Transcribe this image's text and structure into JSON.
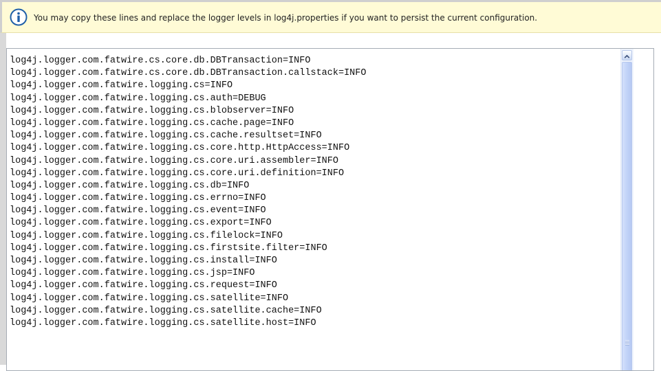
{
  "info_banner": {
    "icon": "info-icon",
    "message": "You may copy these lines and replace the logger levels in log4j.properties if you want to persist the current configuration."
  },
  "config_lines": [
    "log4j.logger.com.fatwire.cs.core.db.DBTransaction=INFO",
    "log4j.logger.com.fatwire.cs.core.db.DBTransaction.callstack=INFO",
    "log4j.logger.com.fatwire.logging.cs=INFO",
    "log4j.logger.com.fatwire.logging.cs.auth=DEBUG",
    "log4j.logger.com.fatwire.logging.cs.blobserver=INFO",
    "log4j.logger.com.fatwire.logging.cs.cache.page=INFO",
    "log4j.logger.com.fatwire.logging.cs.cache.resultset=INFO",
    "log4j.logger.com.fatwire.logging.cs.core.http.HttpAccess=INFO",
    "log4j.logger.com.fatwire.logging.cs.core.uri.assembler=INFO",
    "log4j.logger.com.fatwire.logging.cs.core.uri.definition=INFO",
    "log4j.logger.com.fatwire.logging.cs.db=INFO",
    "log4j.logger.com.fatwire.logging.cs.errno=INFO",
    "log4j.logger.com.fatwire.logging.cs.event=INFO",
    "log4j.logger.com.fatwire.logging.cs.export=INFO",
    "log4j.logger.com.fatwire.logging.cs.filelock=INFO",
    "log4j.logger.com.fatwire.logging.cs.firstsite.filter=INFO",
    "log4j.logger.com.fatwire.logging.cs.install=INFO",
    "log4j.logger.com.fatwire.logging.cs.jsp=INFO",
    "log4j.logger.com.fatwire.logging.cs.request=INFO",
    "log4j.logger.com.fatwire.logging.cs.satellite=INFO",
    "log4j.logger.com.fatwire.logging.cs.satellite.cache=INFO",
    "log4j.logger.com.fatwire.logging.cs.satellite.host=INFO"
  ],
  "scrollbar": {
    "up_icon": "chevron-up-icon",
    "grip_icon": "grip-icon"
  },
  "colors": {
    "banner_background": "#fffbd6",
    "info_icon_blue": "#1f5fa8",
    "scroll_thumb": "#c2d3f8"
  }
}
